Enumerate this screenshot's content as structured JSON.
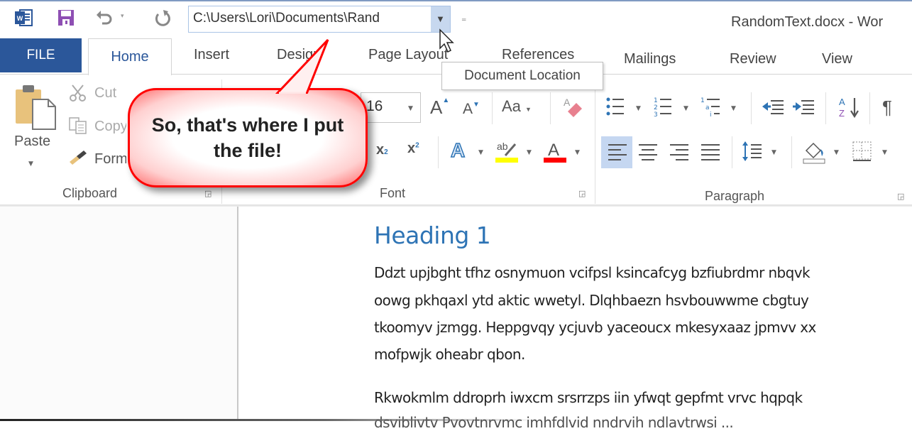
{
  "quick_access": {
    "app_icon": "word-logo-icon",
    "save_icon": "save-icon",
    "undo_icon": "undo-icon",
    "undo_dropdown": "▾",
    "redo_icon": "redo-icon",
    "document_location": "C:\\Users\\Lori\\Documents\\Rand",
    "location_dropdown": "▼",
    "customize": "₌"
  },
  "window": {
    "title": "RandomText.docx - Wor"
  },
  "tabs": {
    "file": "FILE",
    "items": [
      "Home",
      "Insert",
      "Design",
      "Page Layout",
      "References",
      "Mailings",
      "Review",
      "View"
    ],
    "active": "Home"
  },
  "tooltip": {
    "text": "Document Location"
  },
  "ribbon": {
    "clipboard": {
      "label": "Clipboard",
      "paste": "Paste",
      "cut": "Cut",
      "copy": "Copy",
      "format_painter": "Format Painter"
    },
    "font": {
      "label": "Font",
      "size": "16",
      "change_case": "Aa",
      "subscript": "x₂",
      "superscript": "x²",
      "highlight_color": "#ffff00",
      "font_color": "#ff0000"
    },
    "paragraph": {
      "label": "Paragraph",
      "selected_alignment": "left"
    }
  },
  "callout": {
    "text": "So, that's where I put the file!",
    "border_color": "#ff0000"
  },
  "document": {
    "heading": "Heading 1",
    "heading_color": "#2e74b5",
    "paragraph1": [
      "Ddzt upjbght tfhz osnymuon vcifpsl ksincafcyg bzfiubrdmr nbqvk",
      "oowg pkhqaxl ytd aktic wwetyl. Dlqhbaezn hsvbouwwme cbgtuy",
      "tkoomyv jzmgg. Heppgvqy ycjuvb yaceoucx mkesyxaaz jpmvv xx",
      "mofpwjk oheabr qbon."
    ],
    "paragraph2": [
      "Rkwokmlm ddroprh iwxcm srsrrzps iin yfwqt gepfmt vrvc hqpqk",
      "dsviblivtv  Pvovtnrvmc imhfdlvid nndrvih ndlavtrwsi  ..."
    ]
  }
}
